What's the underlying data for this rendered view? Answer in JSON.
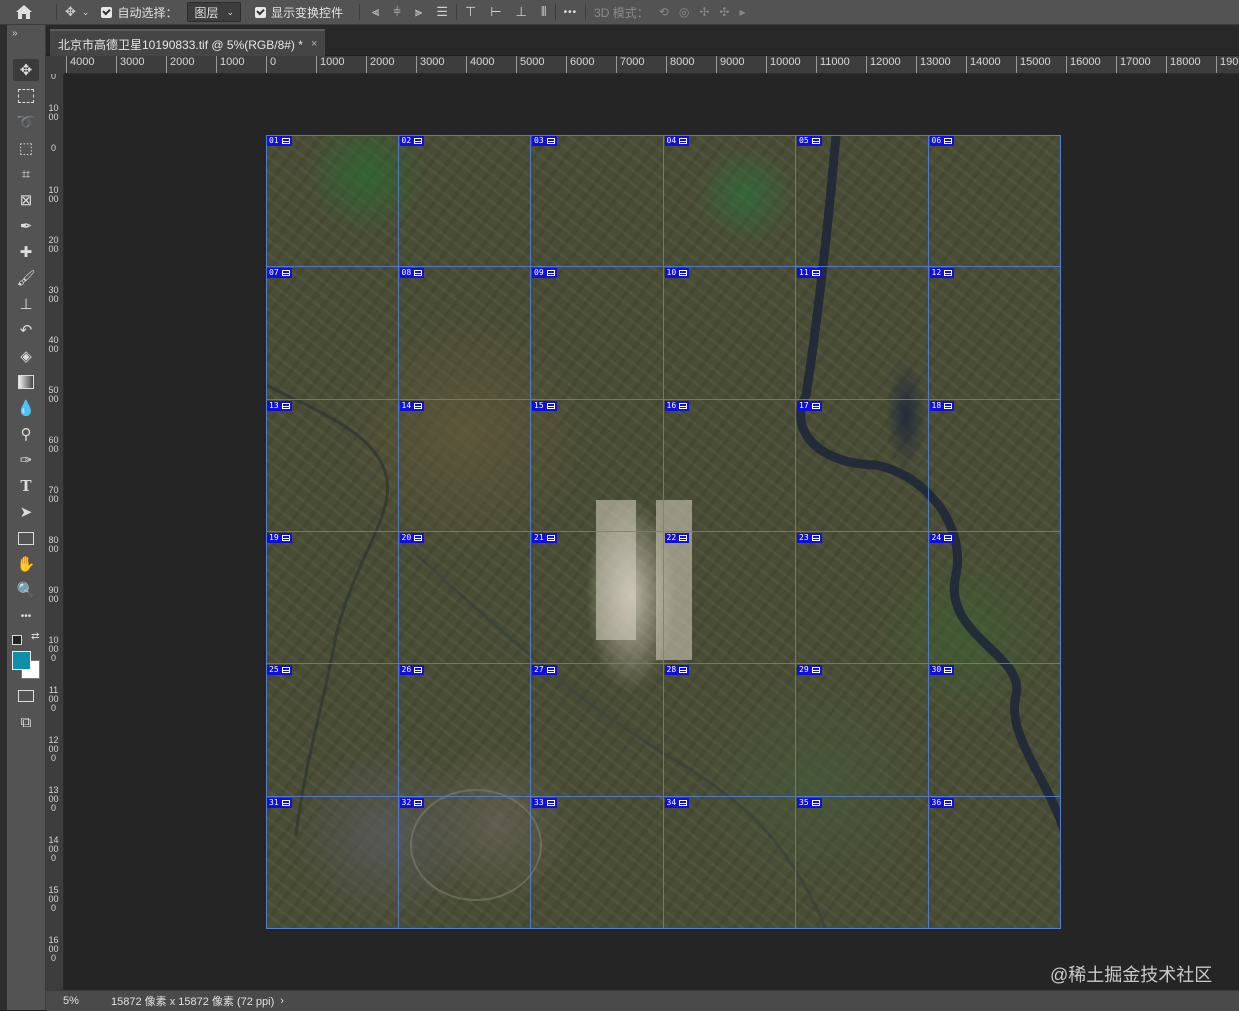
{
  "options_bar": {
    "move_icon": "move-icon",
    "auto_select_label": "自动选择：",
    "auto_select_value": "图层",
    "show_transform_label": "显示变换控件",
    "more_label": "•••",
    "mode_3d_label": "3D 模式："
  },
  "document_tab": {
    "title": "北京市高德卫星10190833.tif @ 5%(RGB/8#) *",
    "close": "×"
  },
  "ruler": {
    "h_labels": [
      "4000",
      "3000",
      "2000",
      "1000",
      "0",
      "1000",
      "2000",
      "3000",
      "4000",
      "5000",
      "6000",
      "7000",
      "8000",
      "9000",
      "10000",
      "11000",
      "12000",
      "13000",
      "14000",
      "15000",
      "16000",
      "17000",
      "18000",
      "190"
    ],
    "v_labels": [
      "0",
      "1000",
      "0",
      "1000",
      "2000",
      "3000",
      "4000",
      "5000",
      "6000",
      "7000",
      "8000",
      "9000",
      "10000",
      "11000",
      "12000",
      "13000",
      "14000",
      "15000",
      "16000"
    ]
  },
  "tiles": [
    "01",
    "02",
    "03",
    "04",
    "05",
    "06",
    "07",
    "08",
    "09",
    "10",
    "11",
    "12",
    "13",
    "14",
    "15",
    "16",
    "17",
    "18",
    "19",
    "20",
    "21",
    "22",
    "23",
    "24",
    "25",
    "26",
    "27",
    "28",
    "29",
    "30",
    "31",
    "32",
    "33",
    "34",
    "35",
    "36"
  ],
  "status": {
    "zoom": "5%",
    "doc_info": "15872 像素 x 15872 像素 (72 ppi)",
    "arrow": "›"
  },
  "watermark": "@稀土掘金技术社区",
  "colors": {
    "foreground": "#0f8fa8",
    "background": "#ffffff",
    "tile_label_bg": "#1010d8",
    "grid": "#5082dc"
  },
  "tools": [
    "move-icon",
    "marquee-icon",
    "lasso-icon",
    "object-select-icon",
    "crop-icon",
    "frame-icon",
    "eyedropper-icon",
    "healing-icon",
    "brush-icon",
    "stamp-icon",
    "history-brush-icon",
    "eraser-icon",
    "gradient-icon",
    "blur-icon",
    "dodge-icon",
    "pen-icon",
    "type-icon",
    "path-select-icon",
    "rectangle-icon",
    "hand-icon",
    "zoom-icon",
    "more-icon"
  ]
}
